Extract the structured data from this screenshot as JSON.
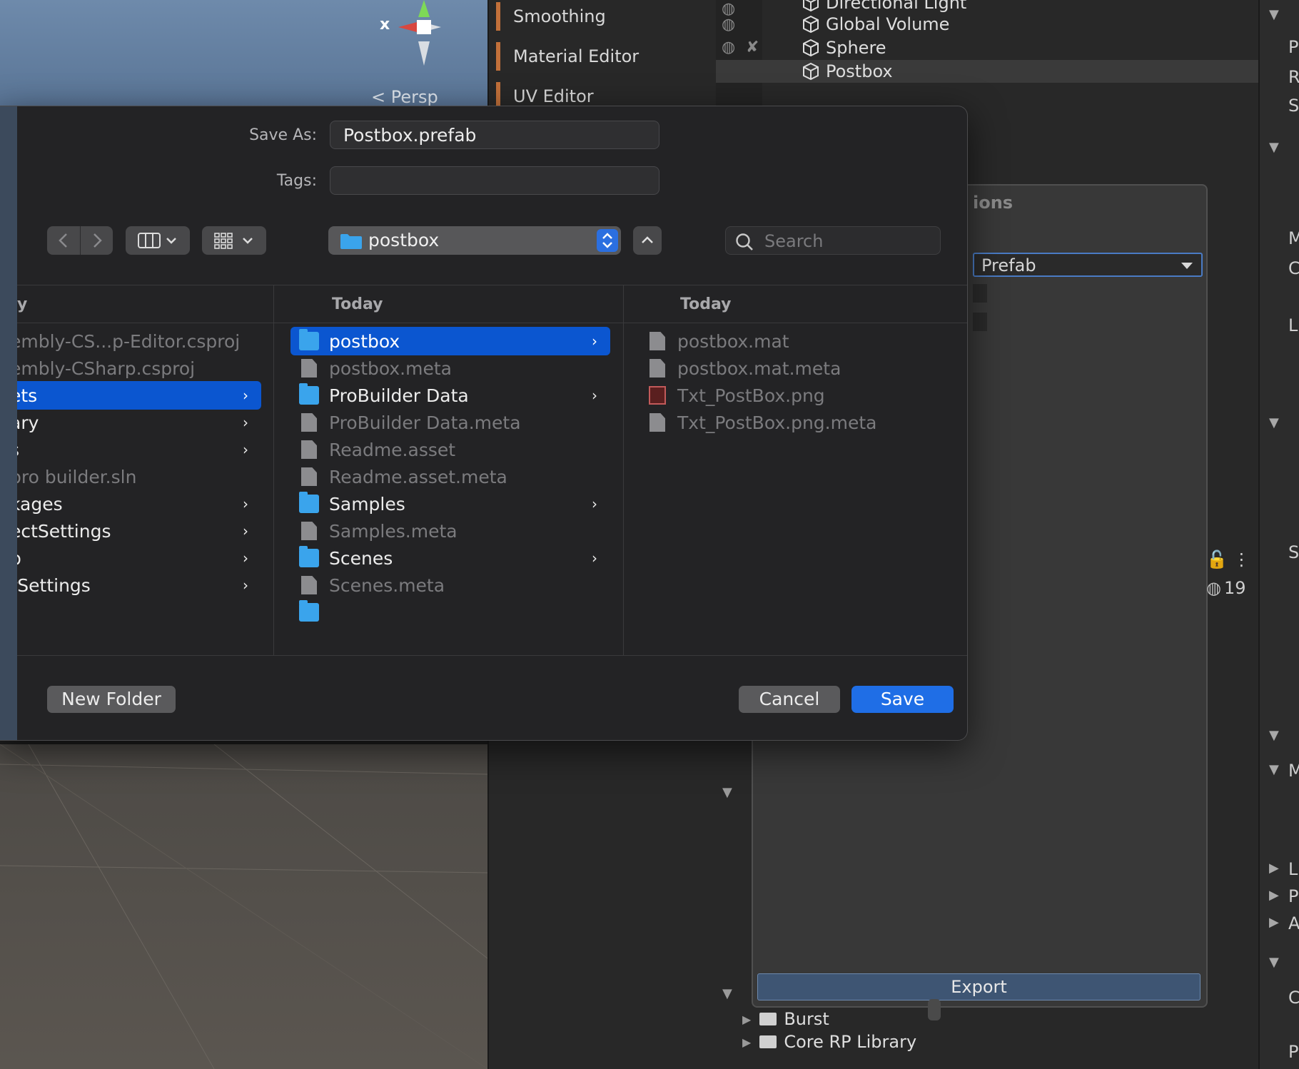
{
  "scene": {
    "axis_label": "x",
    "persp_label": "< Persp"
  },
  "tools": [
    "Smoothing",
    "Material Editor",
    "UV Editor"
  ],
  "hierarchy": [
    "Directional Light",
    "Global Volume",
    "Sphere",
    "Postbox"
  ],
  "export_panel": {
    "title_fragment": "ions",
    "dropdown_value": "Prefab",
    "export_label": "Export",
    "hidden_count": "19"
  },
  "project_tree": [
    "Burst",
    "Core RP Library"
  ],
  "inspector_letters": [
    "P",
    "R",
    "S",
    "M",
    "C",
    "L",
    "S",
    "M",
    "L",
    "P",
    "A",
    "C",
    "P"
  ],
  "dialog": {
    "save_as_label": "Save As:",
    "save_as_value": "Postbox.prefab",
    "tags_label": "Tags:",
    "tags_value": "",
    "location": "postbox",
    "search_placeholder": "Search",
    "column1": {
      "header": "y",
      "items": [
        {
          "label": "embly-CS...p-Editor.csproj",
          "type": "file"
        },
        {
          "label": "embly-CSharp.csproj",
          "type": "file"
        },
        {
          "label": "ets",
          "type": "folder",
          "selected": true
        },
        {
          "label": "ary",
          "type": "folder"
        },
        {
          "label": "s",
          "type": "folder"
        },
        {
          "label": "pro builder.sln",
          "type": "file"
        },
        {
          "label": "kages",
          "type": "folder"
        },
        {
          "label": "ectSettings",
          "type": "folder"
        },
        {
          "label": "p",
          "type": "folder"
        },
        {
          "label": "rSettings",
          "type": "folder"
        }
      ]
    },
    "column2": {
      "header": "Today",
      "items": [
        {
          "label": "postbox",
          "type": "folder",
          "selected": true
        },
        {
          "label": "postbox.meta",
          "type": "file"
        },
        {
          "label": "ProBuilder Data",
          "type": "folder"
        },
        {
          "label": "ProBuilder Data.meta",
          "type": "file"
        },
        {
          "label": "Readme.asset",
          "type": "file"
        },
        {
          "label": "Readme.asset.meta",
          "type": "file"
        },
        {
          "label": "Samples",
          "type": "folder"
        },
        {
          "label": "Samples.meta",
          "type": "file"
        },
        {
          "label": "Scenes",
          "type": "folder"
        },
        {
          "label": "Scenes.meta",
          "type": "file"
        }
      ]
    },
    "column3": {
      "header": "Today",
      "items": [
        {
          "label": "postbox.mat",
          "type": "file"
        },
        {
          "label": "postbox.mat.meta",
          "type": "file"
        },
        {
          "label": "Txt_PostBox.png",
          "type": "image"
        },
        {
          "label": "Txt_PostBox.png.meta",
          "type": "file"
        }
      ]
    },
    "new_folder_label": "New Folder",
    "cancel_label": "Cancel",
    "save_label": "Save"
  },
  "colors": {
    "selection": "#0b56d0",
    "save_button": "#1f6ee6",
    "folder": "#3aa4ec",
    "tool_accent": "#c2703a"
  }
}
